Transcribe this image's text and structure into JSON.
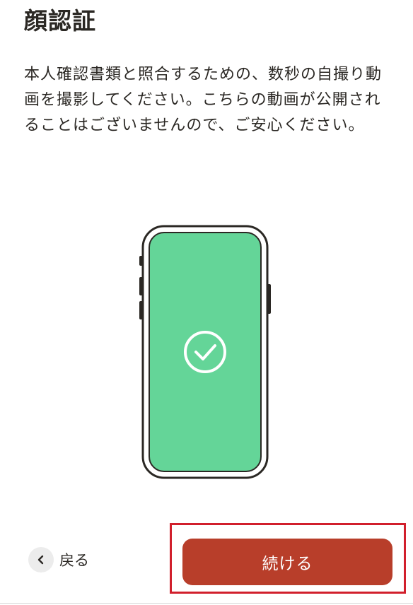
{
  "header": {
    "title": "顔認証"
  },
  "content": {
    "description": "本人確認書類と照合するための、数秒の自撮り動画を撮影してください。こちらの動画が公開されることはございませんので、ご安心ください。"
  },
  "illustration": {
    "phone_icon": "smartphone-icon",
    "check_icon": "check-circle-icon",
    "screen_color": "#64d598",
    "frame_color": "#2b2824"
  },
  "footer": {
    "back_label": "戻る",
    "back_icon": "chevron-left-icon",
    "continue_label": "続ける",
    "continue_color": "#b83e2a",
    "highlight_color": "#d11f2c"
  }
}
